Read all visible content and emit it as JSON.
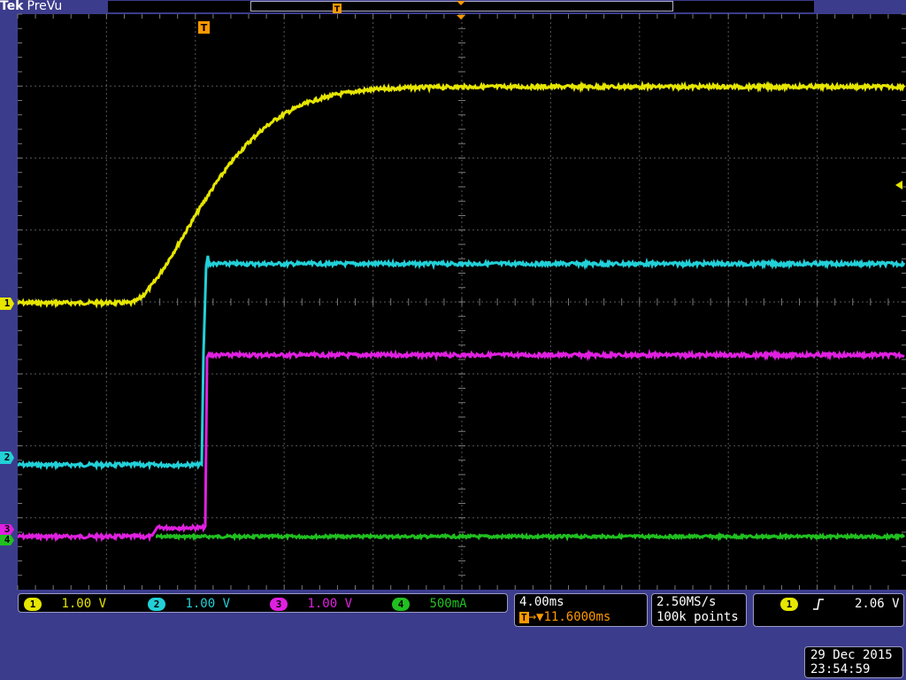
{
  "header": {
    "brand": "Tek",
    "mode": "PreVu",
    "trigger_marker": "T"
  },
  "colors": {
    "ch1": "#e6e600",
    "ch2": "#22d0d8",
    "ch3": "#e020e0",
    "ch4": "#20c020",
    "grid": "#7a7a7a",
    "trigger": "#ff9900"
  },
  "markers": {
    "ch1": "1",
    "ch2": "2",
    "ch3": "3",
    "ch4": "4"
  },
  "channels": [
    {
      "id": "1",
      "scale": "1.00 V"
    },
    {
      "id": "2",
      "scale": "1.00 V"
    },
    {
      "id": "3",
      "scale": "1.00 V"
    },
    {
      "id": "4",
      "scale": "500mA"
    }
  ],
  "timebase": {
    "scale": "4.00ms",
    "delay_icon": "T",
    "delay": "→▼11.6000ms"
  },
  "acquisition": {
    "sample_rate": "2.50MS/s",
    "record_length": "100k points"
  },
  "trigger": {
    "source": "1",
    "slope_icon": "rising-edge-icon",
    "level": "2.06 V"
  },
  "datetime": {
    "date": "29 Dec  2015",
    "time": "23:54:59"
  }
}
